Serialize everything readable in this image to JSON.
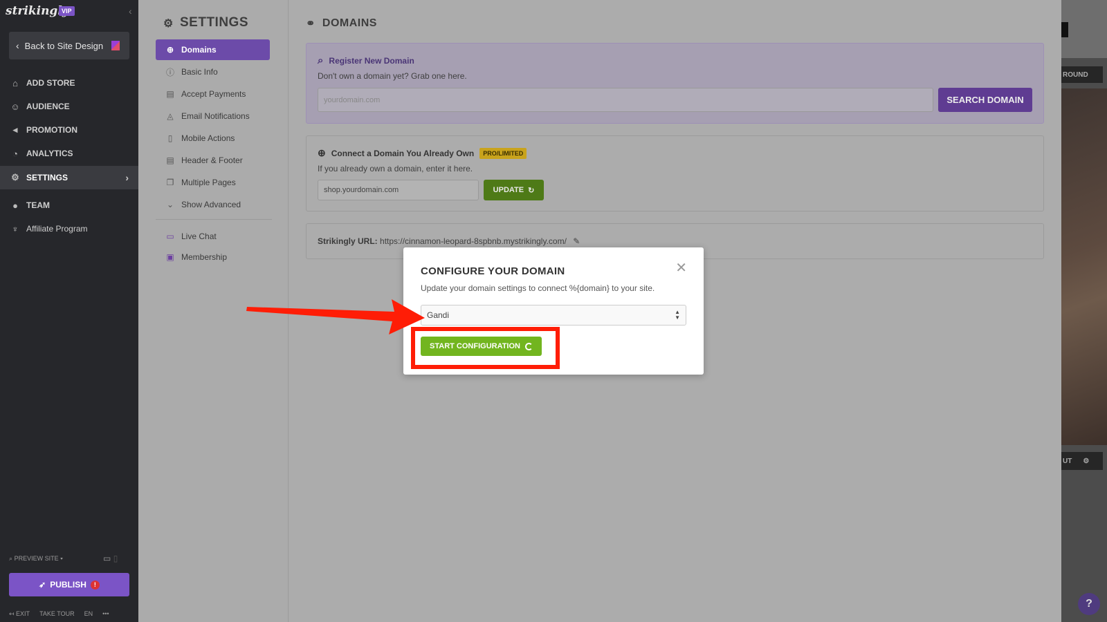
{
  "sidebar": {
    "logo": "strikingly",
    "vip": "VIP",
    "back_label": "Back to Site Design",
    "items": [
      {
        "label": "ADD STORE",
        "icon": "store-icon"
      },
      {
        "label": "AUDIENCE",
        "icon": "audience-icon"
      },
      {
        "label": "PROMOTION",
        "icon": "megaphone-icon"
      },
      {
        "label": "ANALYTICS",
        "icon": "analytics-icon"
      },
      {
        "label": "SETTINGS",
        "icon": "gear-icon"
      },
      {
        "label": "TEAM",
        "icon": "team-icon"
      },
      {
        "label": "Affiliate Program",
        "icon": "trophy-icon"
      }
    ],
    "preview_site": "PREVIEW SITE",
    "publish": "PUBLISH",
    "footer": {
      "exit": "EXIT",
      "tour": "TAKE TOUR",
      "lang": "EN",
      "more": "•••"
    }
  },
  "settings": {
    "title": "SETTINGS",
    "items": [
      {
        "label": "Domains",
        "icon": "globe-icon"
      },
      {
        "label": "Basic Info",
        "icon": "info-icon"
      },
      {
        "label": "Accept Payments",
        "icon": "card-icon"
      },
      {
        "label": "Email Notifications",
        "icon": "bell-icon"
      },
      {
        "label": "Mobile Actions",
        "icon": "mobile-icon"
      },
      {
        "label": "Header & Footer",
        "icon": "layout-icon"
      },
      {
        "label": "Multiple Pages",
        "icon": "pages-icon"
      },
      {
        "label": "Show Advanced",
        "icon": "chevron-down-icon"
      },
      {
        "label": "Live Chat",
        "icon": "chat-icon"
      },
      {
        "label": "Membership",
        "icon": "member-icon"
      }
    ]
  },
  "domains": {
    "title": "DOMAINS",
    "register": {
      "title": "Register New Domain",
      "subtitle": "Don't own a domain yet? Grab one here.",
      "placeholder": "yourdomain.com",
      "button": "SEARCH DOMAIN"
    },
    "connect": {
      "title": "Connect a Domain You Already Own",
      "badge": "PRO/LIMITED",
      "subtitle": "If you already own a domain, enter it here.",
      "value": "shop.yourdomain.com",
      "button": "UPDATE"
    },
    "url": {
      "label": "Strikingly URL:",
      "value": "https://cinnamon-leopard-8spbnb.mystrikingly.com/"
    }
  },
  "modal": {
    "title": "CONFIGURE YOUR DOMAIN",
    "subtitle": "Update your domain settings to connect %{domain} to your site.",
    "provider": "Gandi",
    "button": "START CONFIGURATION"
  },
  "preview": {
    "bar1": "ROUND",
    "bar2": "UT"
  },
  "colors": {
    "accent_purple": "#7b54c6",
    "green": "#72b51f",
    "annotation_red": "#ff1d06"
  }
}
